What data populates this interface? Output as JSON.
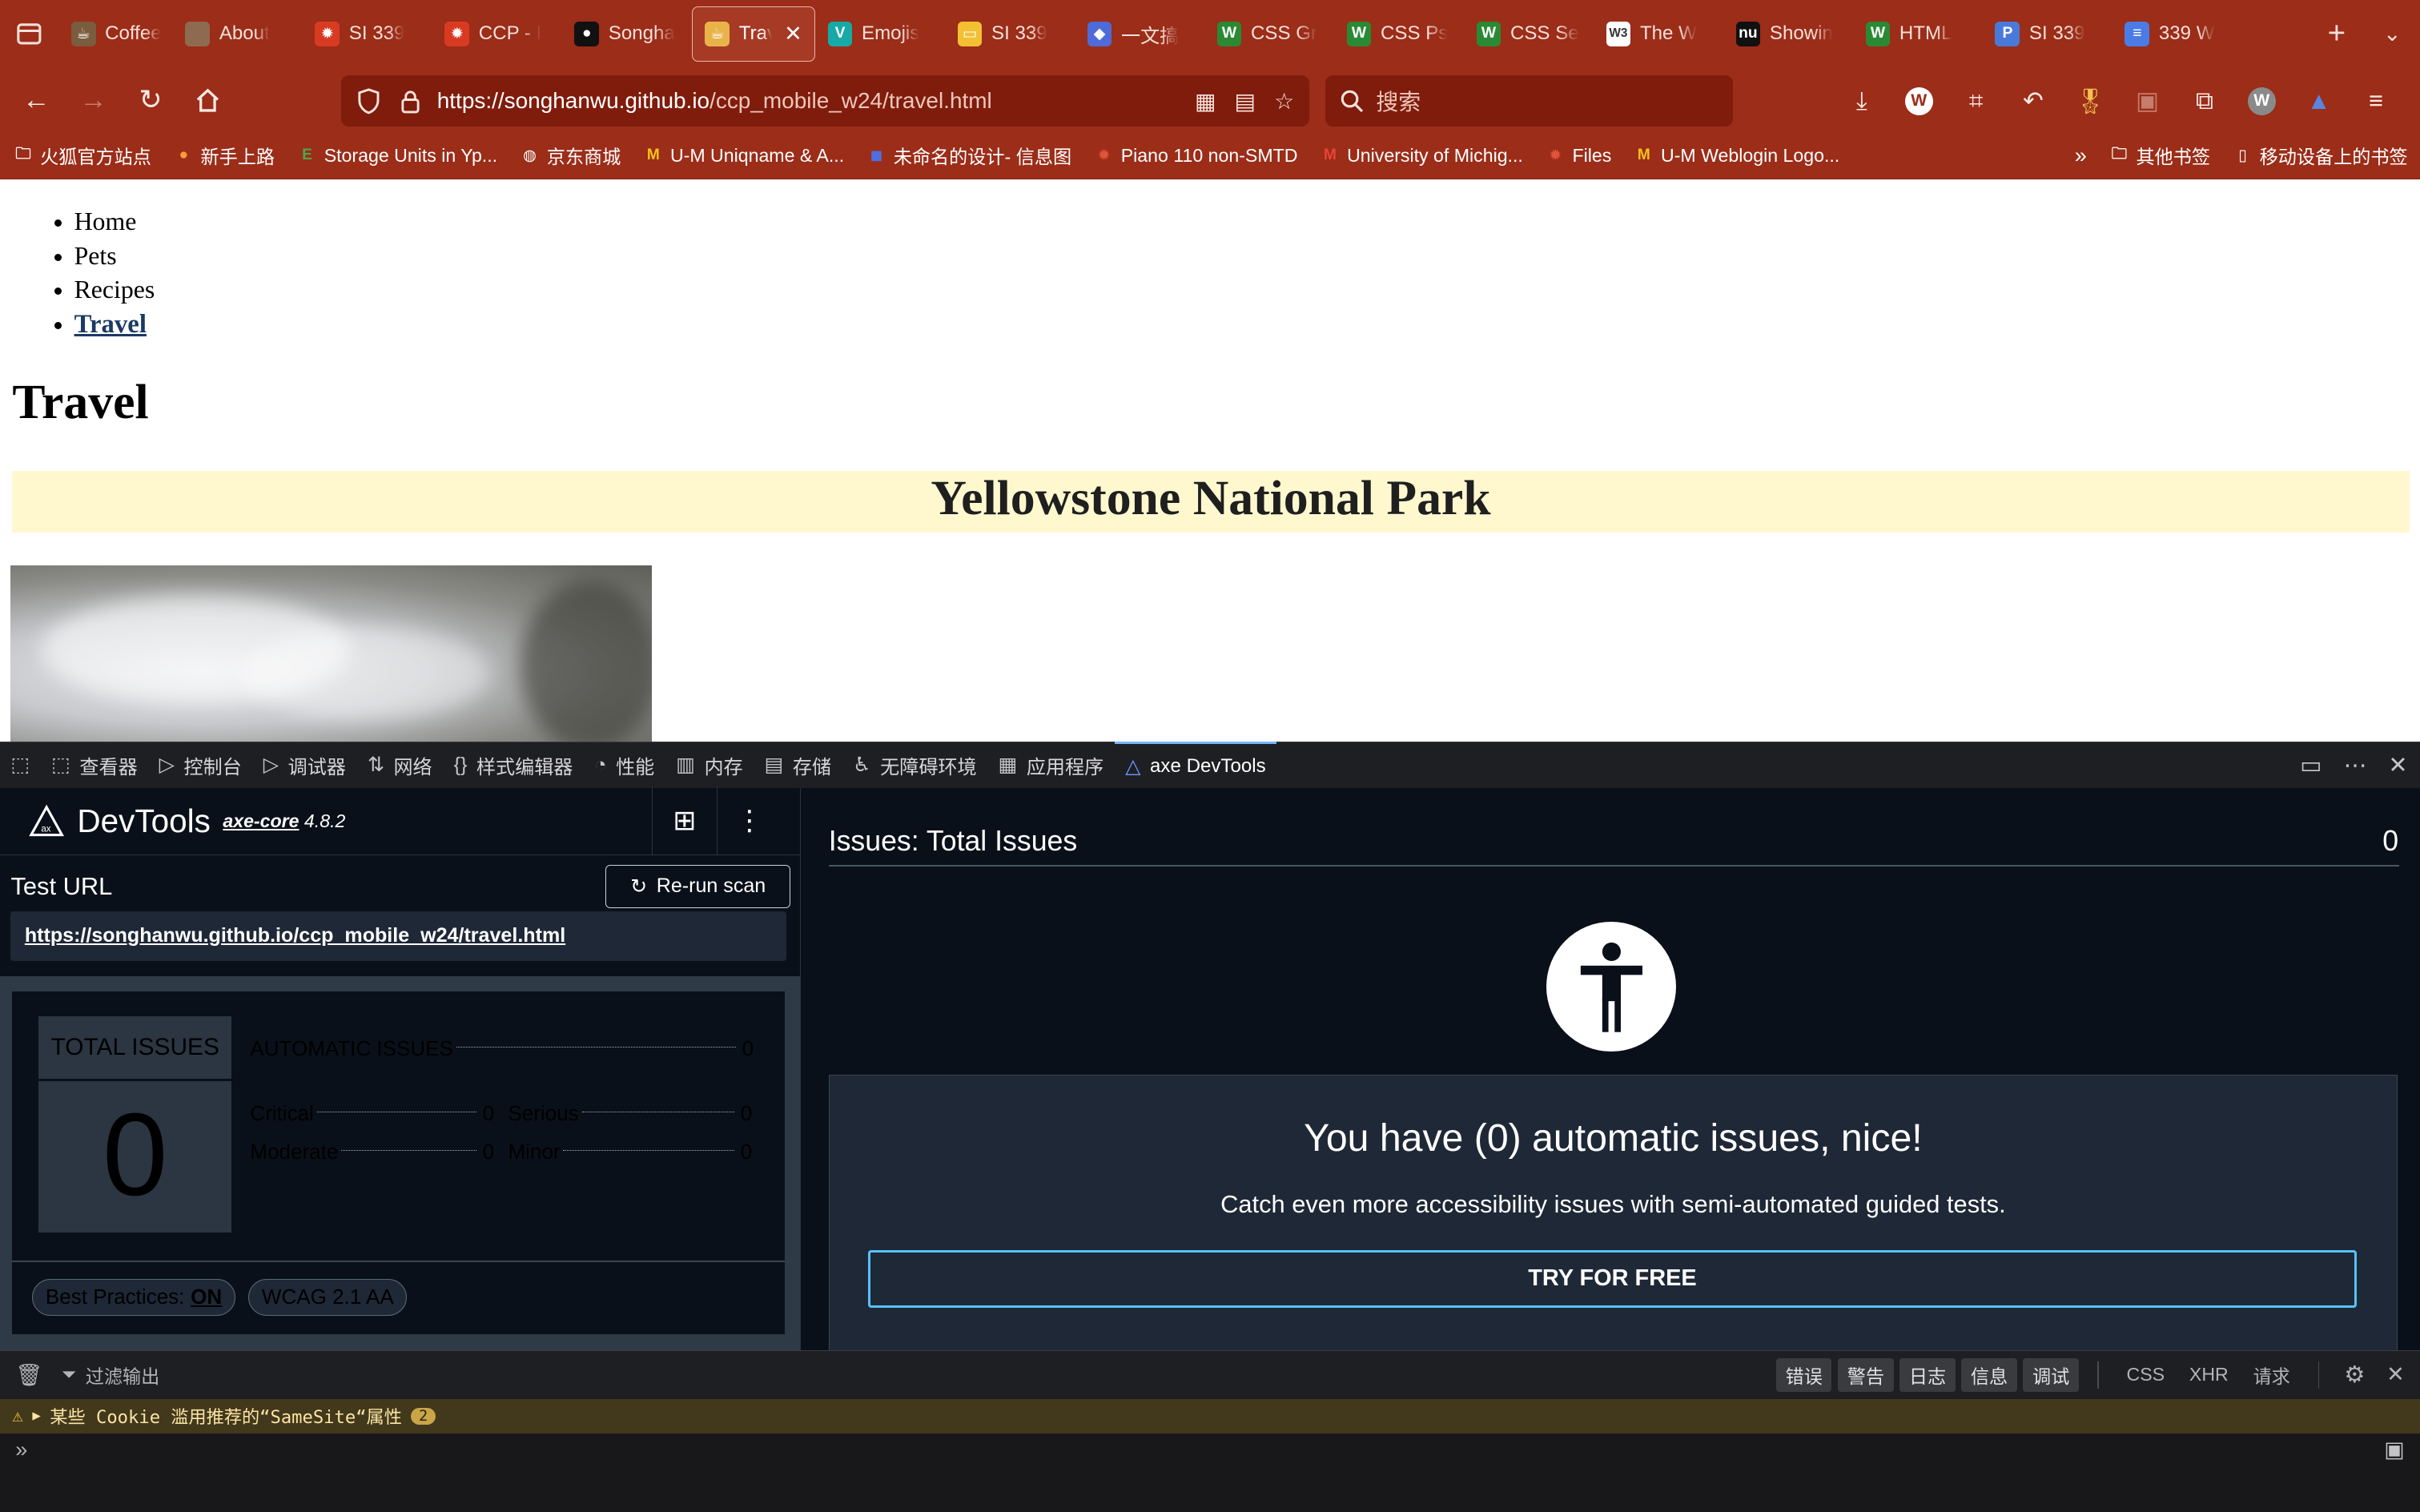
{
  "browser": {
    "tabs": [
      {
        "label": "Coffee",
        "fav_color": "#7a5c3e",
        "fav_glyph": "☕"
      },
      {
        "label": "About",
        "fav_color": "#8e6b50",
        "fav_glyph": ""
      },
      {
        "label": "SI 339",
        "fav_color": "#d93b22",
        "fav_glyph": "✹"
      },
      {
        "label": "CCP - I",
        "fav_color": "#d93b22",
        "fav_glyph": "✹"
      },
      {
        "label": "Songha",
        "fav_color": "#111111",
        "fav_glyph": "●"
      },
      {
        "label": "Trave",
        "fav_color": "#e8b44a",
        "fav_glyph": "☕",
        "active": true
      },
      {
        "label": "Emojis",
        "fav_color": "#17a9a6",
        "fav_glyph": "V"
      },
      {
        "label": "SI 339",
        "fav_color": "#f3c034",
        "fav_glyph": "▭"
      },
      {
        "label": "一文搞",
        "fav_color": "#4e6bd9",
        "fav_glyph": "◆"
      },
      {
        "label": "CSS Gr",
        "fav_color": "#2a8a34",
        "fav_glyph": "W"
      },
      {
        "label": "CSS Ps",
        "fav_color": "#2a8a34",
        "fav_glyph": "W"
      },
      {
        "label": "CSS Se",
        "fav_color": "#2a8a34",
        "fav_glyph": "W"
      },
      {
        "label": "The W",
        "fav_color": "#ffffff",
        "fav_glyph": "W3"
      },
      {
        "label": "Showin",
        "fav_color": "#111111",
        "fav_glyph": "nu"
      },
      {
        "label": "HTML",
        "fav_color": "#2a8a34",
        "fav_glyph": "W"
      },
      {
        "label": "SI 339",
        "fav_color": "#4a7ad9",
        "fav_glyph": "P"
      },
      {
        "label": "339 W",
        "fav_color": "#4b7be5",
        "fav_glyph": "≡"
      }
    ],
    "url_host": "https://songhanwu.github.io",
    "url_path": "/ccp_mobile_w24/travel.html",
    "search_placeholder": "搜索",
    "bookmarks": [
      {
        "label": "火狐官方站点",
        "icon": "folder-icon"
      },
      {
        "label": "新手上路",
        "icon": "firefox-icon"
      },
      {
        "label": "Storage Units in Yp...",
        "icon": "exr-icon"
      },
      {
        "label": "京东商城",
        "icon": "globe-icon"
      },
      {
        "label": "U-M Uniqname & A...",
        "icon": "um-icon"
      },
      {
        "label": "未命名的设计- 信息图",
        "icon": "canva-icon"
      },
      {
        "label": "Piano 110 non-SMTD",
        "icon": "canvas-icon"
      },
      {
        "label": "University of Michig...",
        "icon": "gmail-icon"
      },
      {
        "label": "Files",
        "icon": "canvas-icon"
      },
      {
        "label": "U-M Weblogin Logo...",
        "icon": "um-icon"
      }
    ],
    "bookmarks_other": "其他书签",
    "bookmarks_mobile": "移动设备上的书签"
  },
  "page": {
    "nav": [
      "Home",
      "Pets",
      "Recipes",
      "Travel"
    ],
    "heading": "Travel",
    "banner": "Yellowstone National Park"
  },
  "devtools": {
    "tabs": [
      {
        "label": "查看器",
        "icon": "inspector-icon"
      },
      {
        "label": "控制台",
        "icon": "console-icon"
      },
      {
        "label": "调试器",
        "icon": "debugger-icon"
      },
      {
        "label": "网络",
        "icon": "network-icon"
      },
      {
        "label": "样式编辑器",
        "icon": "style-editor-icon"
      },
      {
        "label": "性能",
        "icon": "performance-icon"
      },
      {
        "label": "内存",
        "icon": "memory-icon"
      },
      {
        "label": "存储",
        "icon": "storage-icon"
      },
      {
        "label": "无障碍环境",
        "icon": "accessibility-icon"
      },
      {
        "label": "应用程序",
        "icon": "application-icon"
      },
      {
        "label": "axe DevTools",
        "icon": "axe-icon",
        "active": true
      }
    ],
    "axe": {
      "brand": "DevTools",
      "core_name": "axe-core",
      "core_version": "4.8.2",
      "test_url_label": "Test URL",
      "rerun_label": "Re-run scan",
      "test_url": "https://songhanwu.github.io/ccp_mobile_w24/travel.html",
      "total_label": "TOTAL ISSUES",
      "total": "0",
      "automatic_label": "AUTOMATIC ISSUES",
      "automatic": "0",
      "critical_label": "Critical",
      "critical": "0",
      "serious_label": "Serious",
      "serious": "0",
      "moderate_label": "Moderate",
      "moderate": "0",
      "minor_label": "Minor",
      "minor": "0",
      "best_practices_label": "Best Practices:",
      "best_practices_value": "ON",
      "standard": "WCAG 2.1 AA",
      "issues_title": "Issues: Total Issues",
      "issues_count": "0",
      "success_message": "You have (0) automatic issues, nice!",
      "success_sub": "Catch even more accessibility issues with semi-automated guided tests.",
      "cta": "TRY FOR FREE"
    },
    "console": {
      "filter_placeholder": "过滤输出",
      "levels": [
        "错误",
        "警告",
        "日志",
        "信息",
        "调试"
      ],
      "types": [
        "CSS",
        "XHR",
        "请求"
      ],
      "warning": "某些 Cookie 滥用推荐的“SameSite“属性",
      "warning_count": "2"
    }
  },
  "colors": {
    "chrome": "#9b2d19",
    "urlbar": "#7f1c0c",
    "devtools_bg": "#0a1019",
    "accent": "#57c2ff",
    "banner_bg": "#fff8cf"
  }
}
